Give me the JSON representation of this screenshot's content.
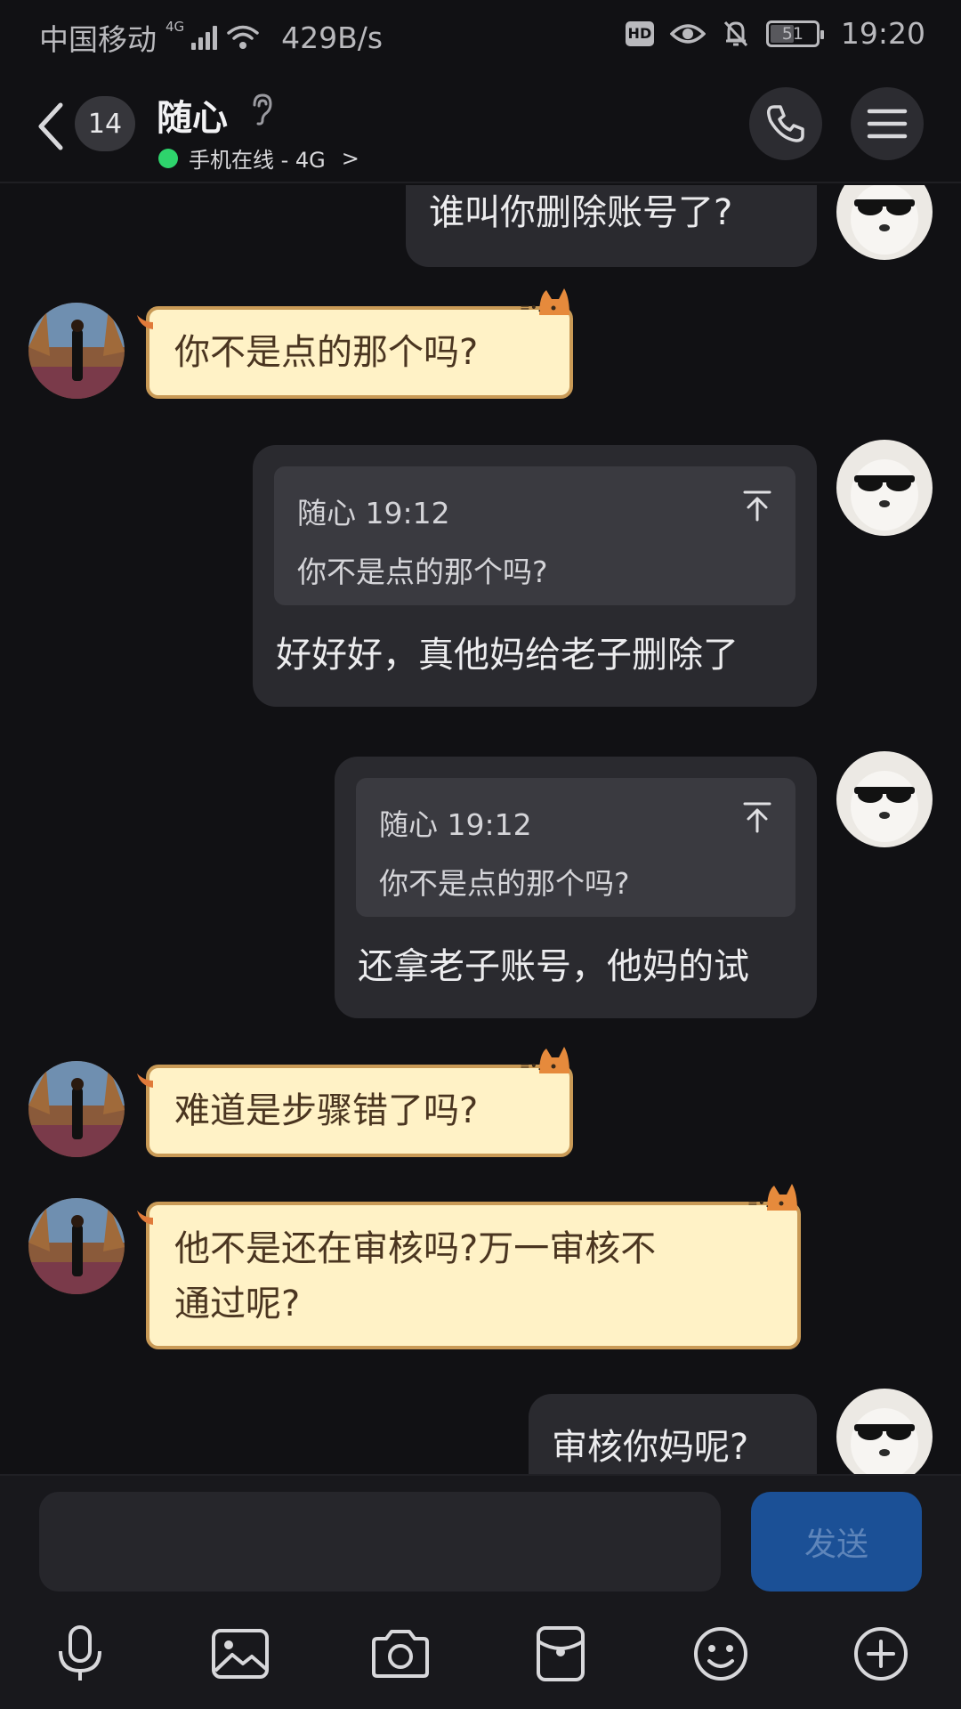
{
  "status_bar": {
    "carrier": "中国移动",
    "network": "4G",
    "speed": "429B/s",
    "hd": "HD",
    "battery": "51",
    "battery_level": 0.51,
    "time": "19:20"
  },
  "header": {
    "unread_count": "14",
    "contact_name": "随心",
    "online_status": "手机在线 - 4G",
    "online_chevron": ">"
  },
  "messages": [
    {
      "side": "out",
      "text": "谁叫你删除账号了?"
    },
    {
      "side": "in",
      "text": "你不是点的那个吗?"
    },
    {
      "side": "out",
      "quote": {
        "author_time": "随心 19:12",
        "text": "你不是点的那个吗?"
      },
      "text": "好好好，真他妈给老子删除了"
    },
    {
      "side": "out",
      "quote": {
        "author_time": "随心 19:12",
        "text": "你不是点的那个吗?"
      },
      "text": "还拿老子账号，他妈的试"
    },
    {
      "side": "in",
      "text": "难道是步骤错了吗?"
    },
    {
      "side": "in",
      "lines": [
        "他不是还在审核吗?万一审核不",
        "通过呢?"
      ]
    },
    {
      "side": "out",
      "text": "审核你妈呢?"
    }
  ],
  "composer": {
    "placeholder": "",
    "send_label": "发送"
  },
  "icons": [
    "back-icon",
    "ear-icon",
    "phone-icon",
    "menu-icon",
    "mic-icon",
    "image-icon",
    "camera-icon",
    "red-packet-icon",
    "emoji-icon",
    "plus-icon"
  ],
  "colors": {
    "background": "#111114",
    "outgoing_bubble": "#2a2a2f",
    "incoming_bubble": "#fff2c6",
    "incoming_border": "#c99a56",
    "send_button": "#1b5096",
    "online_dot": "#2ed46c"
  }
}
